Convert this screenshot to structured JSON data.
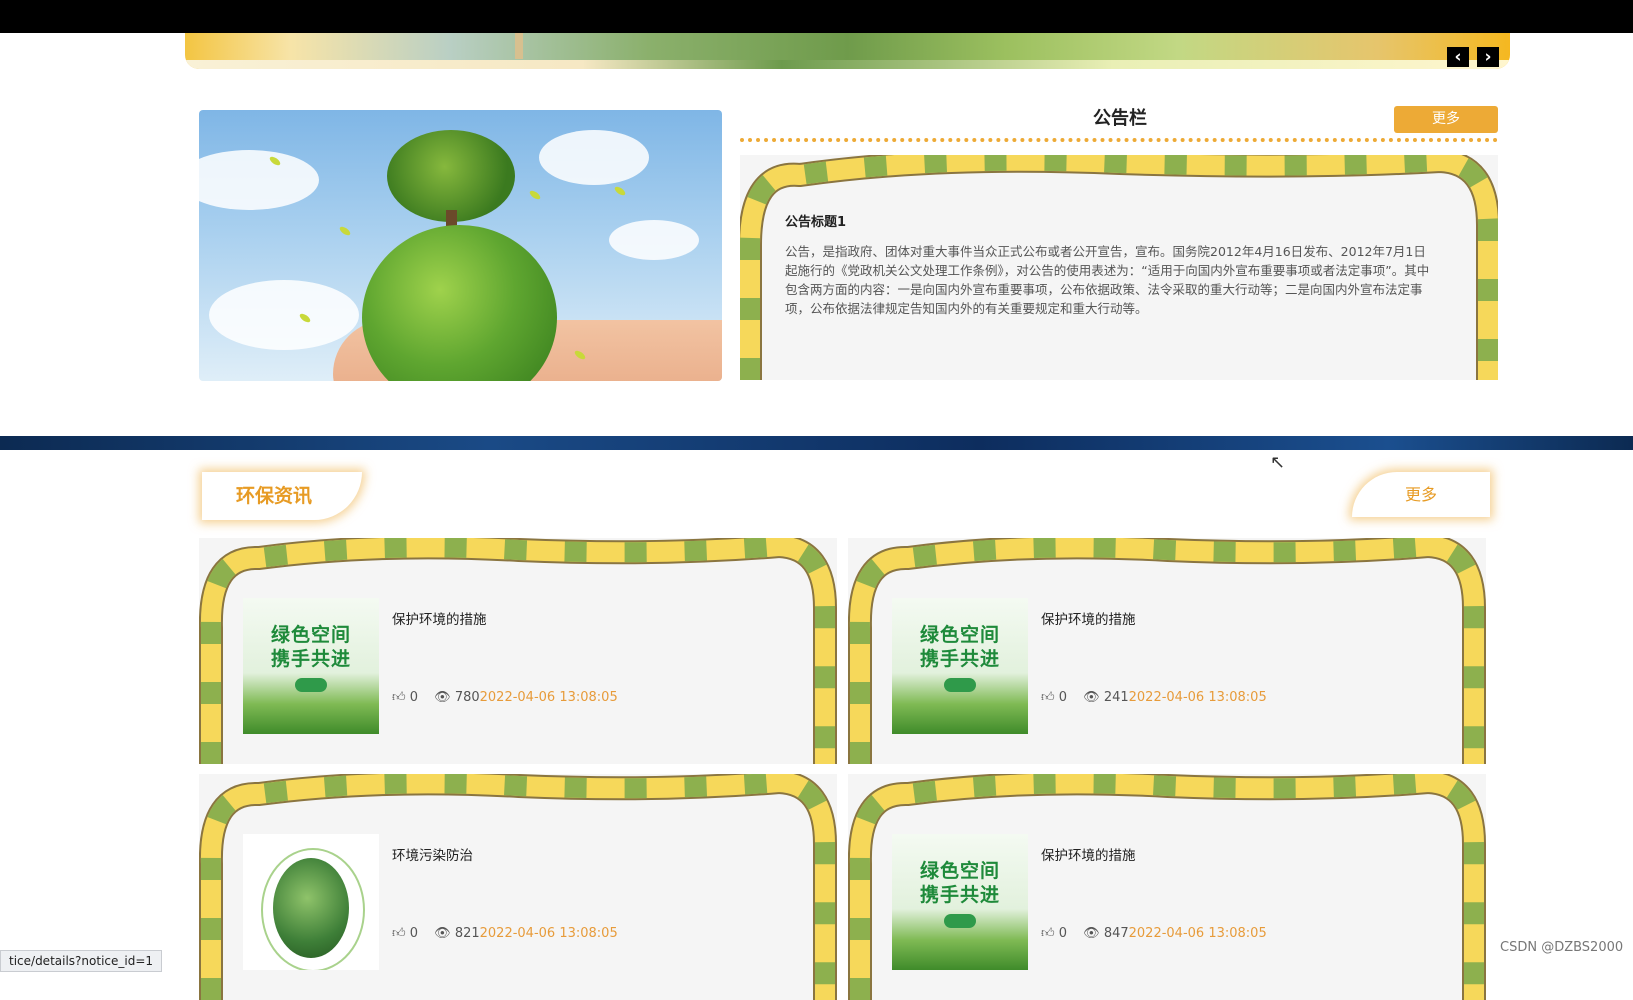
{
  "carousel": {
    "prev_icon": "‹",
    "next_icon": "›"
  },
  "notice_board": {
    "title": "公告栏",
    "more_label": "更多",
    "item": {
      "title": "公告标题1",
      "body": "公告，是指政府、团体对重大事件当众正式公布或者公开宣告，宣布。国务院2012年4月16日发布、2012年7月1日起施行的《党政机关公文处理工作条例》，对公告的使用表述为：“适用于向国内外宣布重要事项或者法定事项”。其中包含两方面的内容：一是向国内外宣布重要事项，公布依据政策、法令采取的重大行动等；二是向国内外宣布法定事项，公布依据法律规定告知国内外的有关重要规定和重大行动等。"
    }
  },
  "news": {
    "title": "环保资讯",
    "more_label": "更多",
    "items": [
      {
        "title": "保护环境的措施",
        "likes": "0",
        "views": "780",
        "date": "2022-04-06 13:08:05",
        "thumb": "green-poster",
        "poster_line1": "绿色空间",
        "poster_line2": "携手共进"
      },
      {
        "title": "保护环境的措施",
        "likes": "0",
        "views": "241",
        "date": "2022-04-06 13:08:05",
        "thumb": "green-poster",
        "poster_line1": "绿色空间",
        "poster_line2": "携手共进"
      },
      {
        "title": "环境污染防治",
        "likes": "0",
        "views": "821",
        "date": "2022-04-06 13:08:05",
        "thumb": "globe"
      },
      {
        "title": "保护环境的措施",
        "likes": "0",
        "views": "847",
        "date": "2022-04-06 13:08:05",
        "thumb": "green-poster",
        "poster_line1": "绿色空间",
        "poster_line2": "携手共进"
      }
    ]
  },
  "status_bar": {
    "url": "tice/details?notice_id=1"
  },
  "watermark": "CSDN @DZBS2000",
  "colors": {
    "accent": "#edaa36",
    "frame_yellow": "#f6d85a",
    "frame_green": "#8db04e"
  }
}
